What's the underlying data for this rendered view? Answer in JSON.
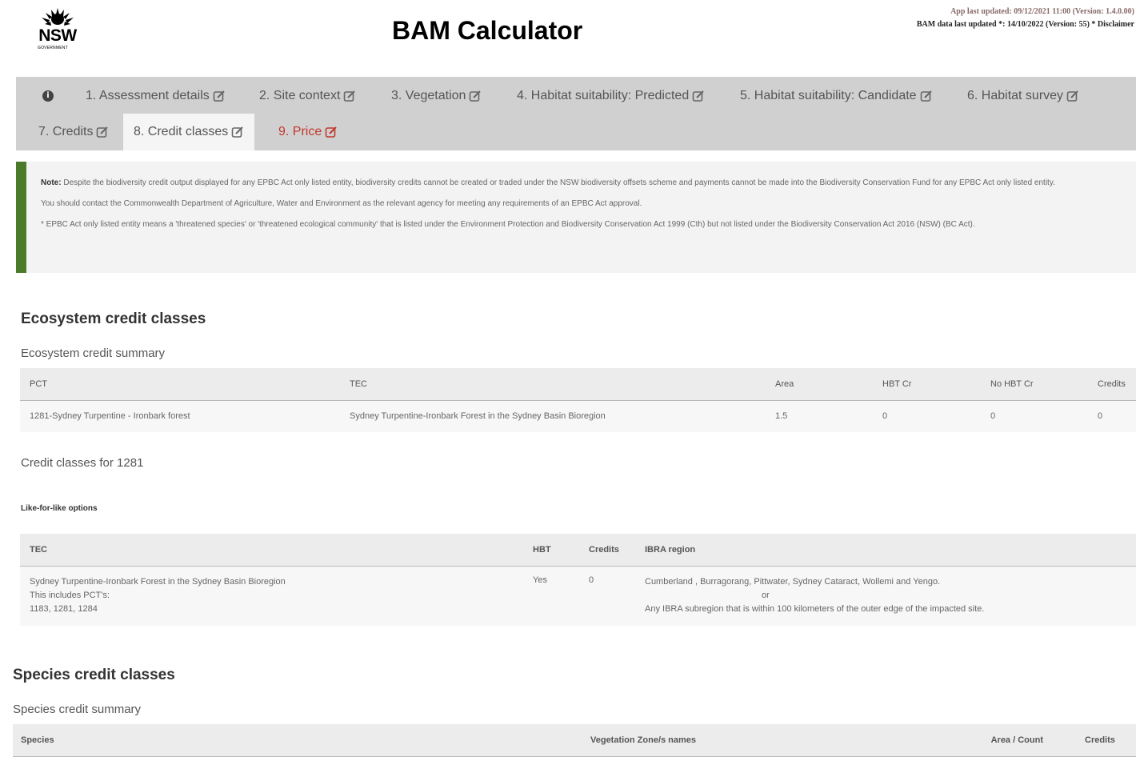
{
  "header": {
    "title": "BAM Calculator",
    "logo_text": "NSW",
    "logo_subtext": "GOVERNMENT",
    "app_updated": "App last updated: 09/12/2021 11:00 (Version: 1.4.0.00)",
    "data_updated": "BAM data last updated *: 14/10/2022 (Version: 55) *",
    "disclaimer": "Disclaimer"
  },
  "tabs": [
    {
      "label": "1. Assessment details"
    },
    {
      "label": "2. Site context"
    },
    {
      "label": "3. Vegetation"
    },
    {
      "label": "4. Habitat suitability: Predicted"
    },
    {
      "label": "5. Habitat suitability: Candidate"
    },
    {
      "label": "6. Habitat survey"
    },
    {
      "label": "7. Credits"
    },
    {
      "label": "8. Credit classes"
    },
    {
      "label": "9. Price"
    }
  ],
  "colors": {
    "accent_green": "#4a7a2a",
    "price_red": "#c0392b"
  },
  "note": {
    "label": "Note:",
    "p1": "Despite the biodiversity credit output displayed for any EPBC Act only listed entity, biodiversity credits cannot be created or traded under the NSW biodiversity offsets scheme and payments cannot be made into the Biodiversity Conservation Fund for any EPBC Act only listed entity.",
    "p2": "You should contact the Commonwealth Department of Agriculture, Water and Environment as the relevant agency for meeting any requirements of an EPBC Act approval.",
    "p3": "* EPBC Act only listed entity means a 'threatened species' or 'threatened ecological community' that is listed under the Environment Protection and Biodiversity Conservation Act 1999 (Cth) but not listed under the Biodiversity Conservation Act 2016 (NSW) (BC Act)."
  },
  "ecosystem": {
    "heading": "Ecosystem credit classes",
    "summary_title": "Ecosystem credit summary",
    "columns": [
      "PCT",
      "TEC",
      "Area",
      "HBT Cr",
      "No HBT Cr",
      "Credits"
    ],
    "row": [
      "1281-Sydney Turpentine - Ironbark forest",
      "Sydney Turpentine-Ironbark Forest in the Sydney Basin Bioregion",
      "1.5",
      "0",
      "0",
      "0"
    ],
    "classes_title": "Credit classes for 1281",
    "like_title": "Like-for-like options",
    "like_columns": [
      "TEC",
      "HBT",
      "Credits",
      "IBRA region"
    ],
    "like_row": {
      "tec_line1": "Sydney Turpentine-Ironbark Forest in the Sydney Basin Bioregion",
      "tec_line2": "This includes PCT's:",
      "tec_line3": "1183, 1281, 1284",
      "hbt": "Yes",
      "credits": "0",
      "ibra_line1": "Cumberland , Burragorang, Pittwater, Sydney Cataract, Wollemi and Yengo.",
      "ibra_or": "or",
      "ibra_line2": "Any IBRA subregion that is within 100 kilometers of the outer edge of the impacted site."
    }
  },
  "species": {
    "heading": "Species credit classes",
    "summary_title": "Species credit summary",
    "columns": [
      "Species",
      "Vegetation Zone/s names",
      "Area / Count",
      "Credits"
    ]
  }
}
